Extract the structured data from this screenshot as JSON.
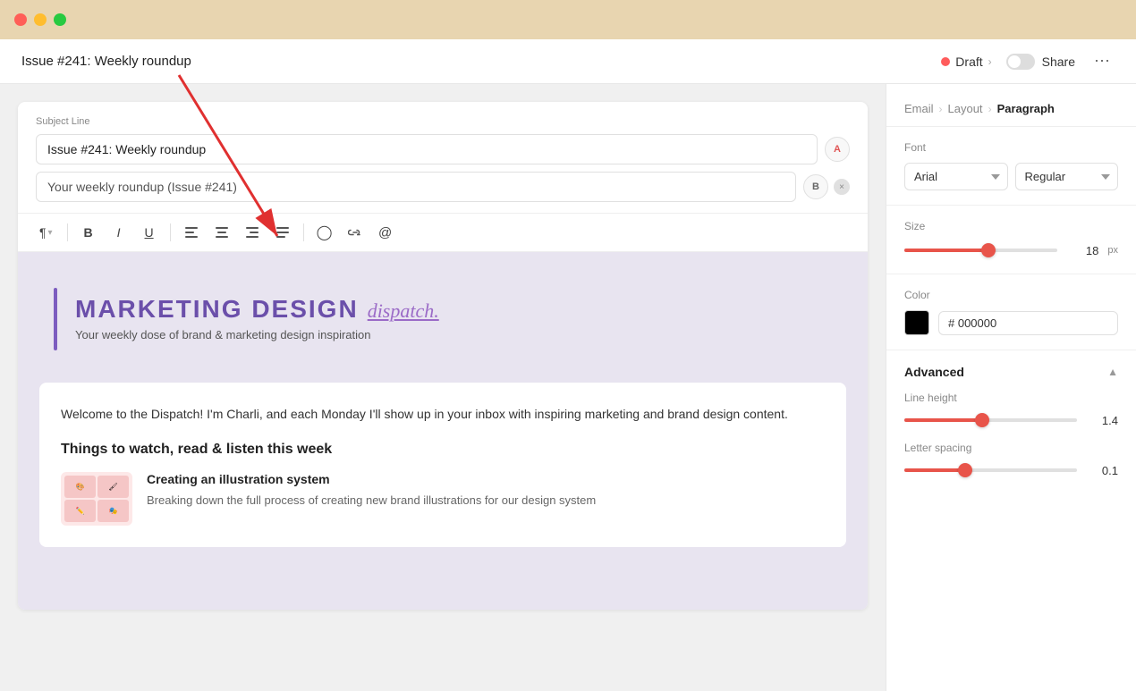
{
  "window": {
    "title": "Issue #241: Weekly roundup"
  },
  "header": {
    "title": "Issue #241: Weekly roundup",
    "status": "Draft",
    "share_label": "Share"
  },
  "breadcrumb": {
    "email": "Email",
    "layout": "Layout",
    "current": "Paragraph"
  },
  "subject": {
    "label": "Subject Line",
    "a_value": "Issue #241: Weekly roundup",
    "b_value": "Your weekly roundup (Issue #241)",
    "a_badge": "A",
    "b_badge": "B"
  },
  "toolbar": {
    "para_label": "¶",
    "bold": "B",
    "italic": "I",
    "underline": "U"
  },
  "email": {
    "brand_title": "MARKETING DESIGN",
    "brand_script": "dispatch.",
    "tagline": "Your weekly dose of brand & marketing design inspiration",
    "body_text": "Welcome to the Dispatch! I'm Charli, and each Monday I'll show up in your inbox with inspiring marketing and brand design content.",
    "section_title": "Things to watch, read & listen this week",
    "article_title": "Creating an illustration system",
    "article_desc": "Breaking down the full process of creating new brand illustrations for our design system"
  },
  "font_panel": {
    "font_label": "Font",
    "font_family": "Arial",
    "font_style": "Regular",
    "size_label": "Size",
    "size_value": "18",
    "size_unit": "px",
    "size_percent": 55,
    "color_label": "Color",
    "color_hex": "# 000000",
    "advanced_label": "Advanced",
    "line_height_label": "Line height",
    "line_height_value": "1.4",
    "line_height_percent": 45,
    "letter_spacing_label": "Letter spacing",
    "letter_spacing_value": "0.1",
    "letter_spacing_percent": 35
  }
}
